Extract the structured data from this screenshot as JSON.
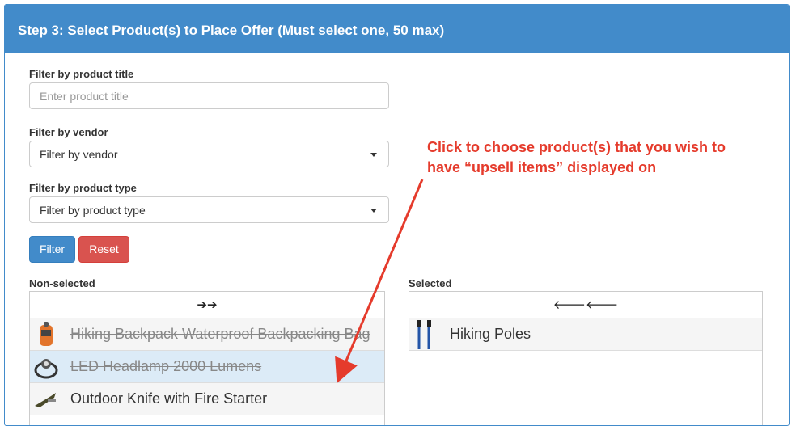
{
  "header": {
    "title": "Step 3: Select Product(s) to Place Offer (Must select one, 50 max)"
  },
  "filters": {
    "title_label": "Filter by product title",
    "title_placeholder": "Enter product title",
    "vendor_label": "Filter by vendor",
    "vendor_value": "Filter by vendor",
    "type_label": "Filter by product type",
    "type_value": "Filter by product type"
  },
  "buttons": {
    "filter": "Filter",
    "reset": "Reset"
  },
  "non_selected": {
    "label": "Non-selected",
    "move_symbol": "➔➔",
    "items": [
      {
        "name": "Hiking Backpack Waterproof Backpacking Bag",
        "state": "disabled"
      },
      {
        "name": "LED Headlamp 2000 Lumens",
        "state": "disabled-highlighted"
      },
      {
        "name": "Outdoor Knife with Fire Starter",
        "state": "normal"
      }
    ]
  },
  "selected": {
    "label": "Selected",
    "move_symbol": "🡐🡐",
    "items": [
      {
        "name": "Hiking Poles"
      }
    ]
  },
  "annotation": {
    "line1": "Click to choose product(s) that you wish to",
    "line2": "have “upsell items” displayed on"
  },
  "colors": {
    "primary": "#428bca",
    "danger": "#d9534f",
    "annotation": "#e53b2c",
    "highlight": "#dcebf7"
  }
}
